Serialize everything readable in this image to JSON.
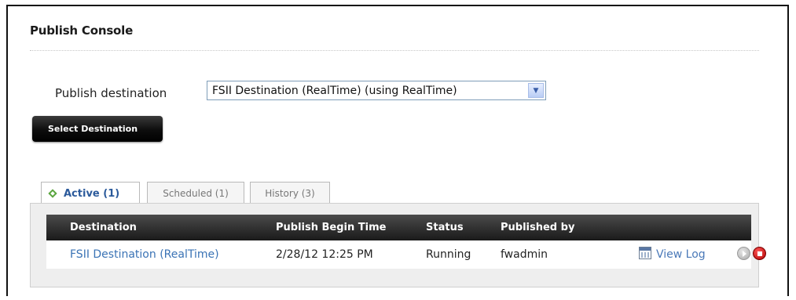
{
  "page": {
    "title": "Publish Console"
  },
  "destination": {
    "label": "Publish destination",
    "selected": "FSII Destination (RealTime) (using RealTime)",
    "button_label": "Select Destination"
  },
  "tabs": [
    {
      "label": "Active (1)",
      "active": true
    },
    {
      "label": "Scheduled (1)",
      "active": false
    },
    {
      "label": "History (3)",
      "active": false
    }
  ],
  "table": {
    "columns": [
      "Destination",
      "Publish Begin Time",
      "Status",
      "Published by"
    ],
    "rows": [
      {
        "destination": "FSII Destination (RealTime)",
        "begin_time": "2/28/12 12:25 PM",
        "status": "Running",
        "published_by": "fwadmin",
        "view_log_label": "View Log",
        "icons": [
          "calendar-icon",
          "play-icon",
          "stop-icon"
        ]
      }
    ]
  },
  "colors": {
    "link": "#3a73b5",
    "active_tab_text": "#2b5a9b",
    "active_tab_icon": "#5aa53e",
    "header_bg": "#1a1a1a",
    "stop": "#c00000"
  }
}
